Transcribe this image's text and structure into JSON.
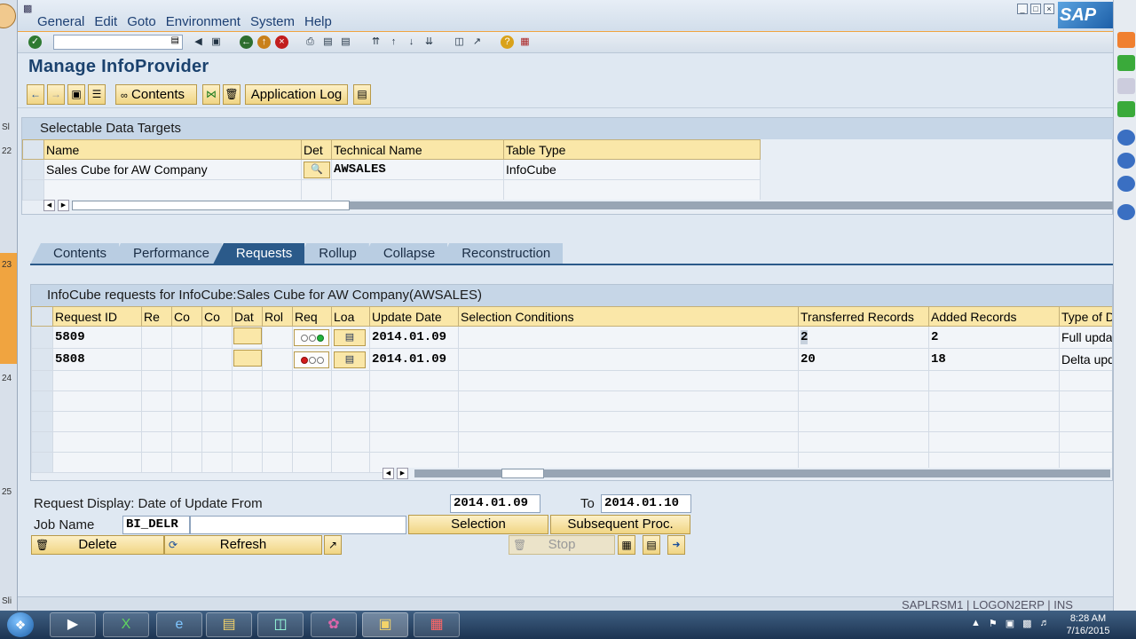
{
  "menu": [
    "General",
    "Edit",
    "Goto",
    "Environment",
    "System",
    "Help"
  ],
  "left_strip_labels": [
    "Sl",
    "22",
    "23",
    "24",
    "25",
    "Sli"
  ],
  "title": "Manage InfoProvider",
  "app_toolbar": {
    "contents": "Contents",
    "application_log": "Application Log"
  },
  "data_targets": {
    "header": "Selectable Data Targets",
    "columns": [
      "Name",
      "Det",
      "Technical Name",
      "Table Type"
    ],
    "rows": [
      {
        "name": "Sales Cube for AW Company",
        "technical_name": "AWSALES",
        "table_type": "InfoCube"
      }
    ]
  },
  "tabs": [
    "Contents",
    "Performance",
    "Requests",
    "Rollup",
    "Collapse",
    "Reconstruction"
  ],
  "active_tab": "Requests",
  "requests": {
    "header": "InfoCube requests for InfoCube:Sales Cube for AW Company(AWSALES)",
    "columns": [
      "Request ID",
      "Re",
      "Co",
      "Co",
      "Dat",
      "Rol",
      "Req",
      "Loa",
      "Update Date",
      "Selection Conditions",
      "Transferred Records",
      "Added Records",
      "Type of Dat"
    ],
    "rows": [
      {
        "request_id": "5809",
        "req_status": "green",
        "update_date": "2014.01.09",
        "transferred": "2",
        "added": "2",
        "type": "Full update"
      },
      {
        "request_id": "5808",
        "req_status": "red",
        "update_date": "2014.01.09",
        "transferred": "20",
        "added": "18",
        "type": "Delta updat"
      }
    ]
  },
  "form": {
    "date_label": "Request Display: Date of Update From",
    "date_from": "2014.01.09",
    "to_label": "To",
    "date_to": "2014.01.10",
    "job_label": "Job Name",
    "job_prefix": "BI_DELR",
    "selection": "Selection",
    "subsequent": "Subsequent Proc.",
    "delete": "Delete",
    "refresh": "Refresh",
    "stop": "Stop"
  },
  "status": {
    "text": "SAPLRSM1 | LOGON2ERP | INS"
  },
  "clock": {
    "time": "8:28 AM",
    "date": "7/16/2015"
  },
  "colors": {
    "accent": "#f0a440",
    "tab_active": "#2b5a8a",
    "header_cell": "#fae7a8",
    "title": "#1b426e"
  }
}
